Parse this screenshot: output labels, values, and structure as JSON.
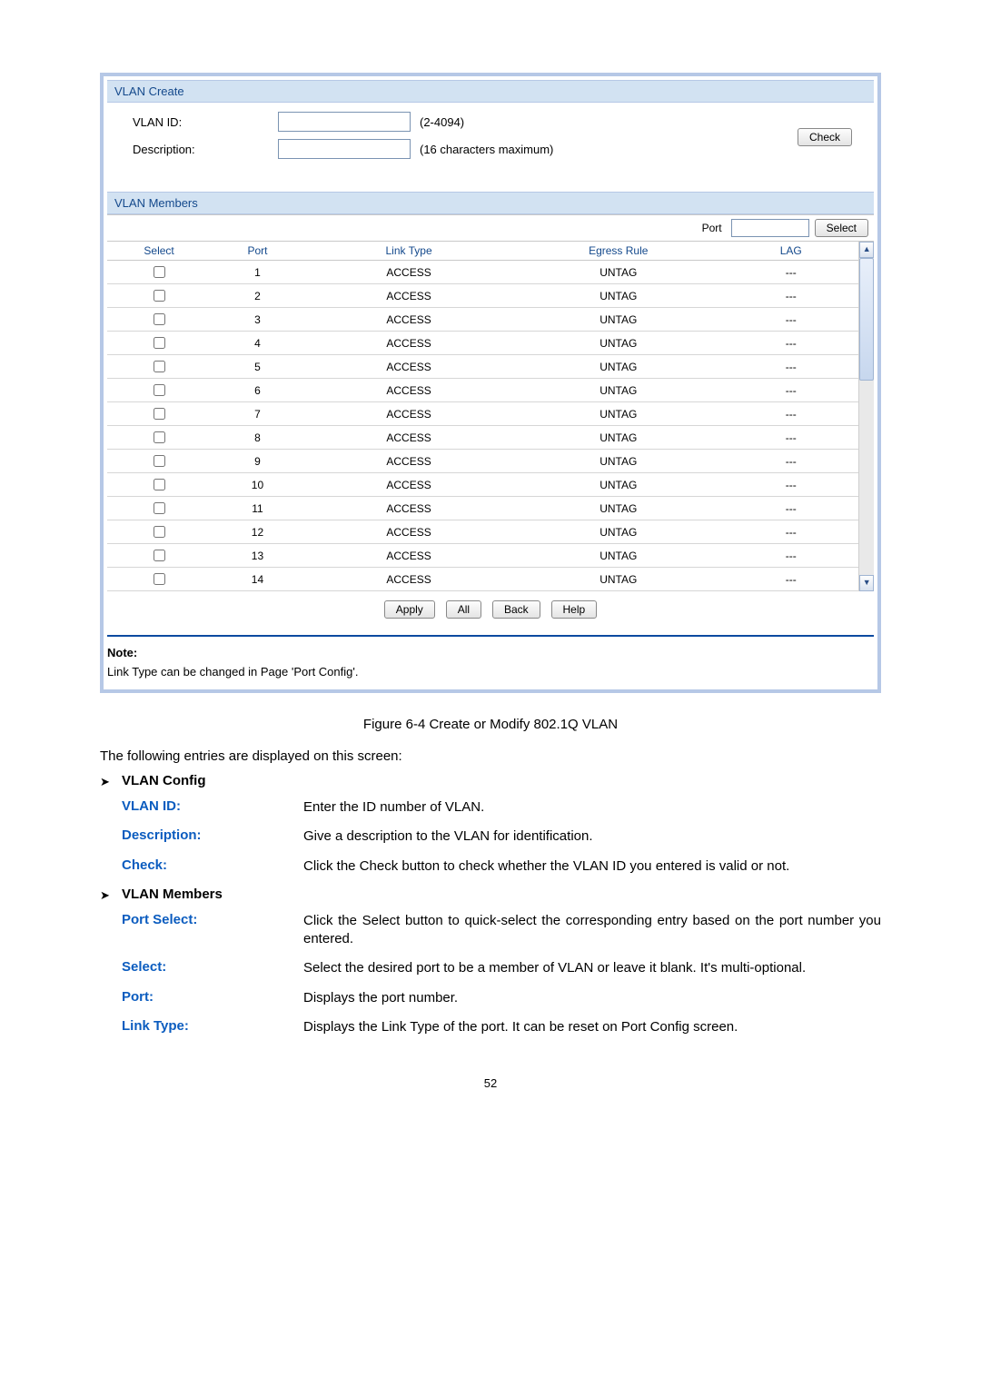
{
  "app": {
    "vlan_create": {
      "title": "VLAN Create",
      "vlan_id_label": "VLAN ID:",
      "vlan_id_value": "",
      "vlan_id_hint": "(2-4094)",
      "description_label": "Description:",
      "description_value": "",
      "description_hint": "(16 characters maximum)",
      "check_btn": "Check"
    },
    "vlan_members": {
      "title": "VLAN Members",
      "port_label": "Port",
      "port_value": "",
      "select_btn": "Select",
      "columns": {
        "select": "Select",
        "port": "Port",
        "link_type": "Link Type",
        "egress_rule": "Egress Rule",
        "lag": "LAG"
      },
      "rows": [
        {
          "port": "1",
          "link": "ACCESS",
          "egress": "UNTAG",
          "lag": "---"
        },
        {
          "port": "2",
          "link": "ACCESS",
          "egress": "UNTAG",
          "lag": "---"
        },
        {
          "port": "3",
          "link": "ACCESS",
          "egress": "UNTAG",
          "lag": "---"
        },
        {
          "port": "4",
          "link": "ACCESS",
          "egress": "UNTAG",
          "lag": "---"
        },
        {
          "port": "5",
          "link": "ACCESS",
          "egress": "UNTAG",
          "lag": "---"
        },
        {
          "port": "6",
          "link": "ACCESS",
          "egress": "UNTAG",
          "lag": "---"
        },
        {
          "port": "7",
          "link": "ACCESS",
          "egress": "UNTAG",
          "lag": "---"
        },
        {
          "port": "8",
          "link": "ACCESS",
          "egress": "UNTAG",
          "lag": "---"
        },
        {
          "port": "9",
          "link": "ACCESS",
          "egress": "UNTAG",
          "lag": "---"
        },
        {
          "port": "10",
          "link": "ACCESS",
          "egress": "UNTAG",
          "lag": "---"
        },
        {
          "port": "11",
          "link": "ACCESS",
          "egress": "UNTAG",
          "lag": "---"
        },
        {
          "port": "12",
          "link": "ACCESS",
          "egress": "UNTAG",
          "lag": "---"
        },
        {
          "port": "13",
          "link": "ACCESS",
          "egress": "UNTAG",
          "lag": "---"
        },
        {
          "port": "14",
          "link": "ACCESS",
          "egress": "UNTAG",
          "lag": "---"
        }
      ],
      "buttons": {
        "apply": "Apply",
        "all": "All",
        "back": "Back",
        "help": "Help"
      }
    },
    "note_label": "Note:",
    "note_body": "Link Type can be changed in Page 'Port Config'."
  },
  "doc": {
    "figure": "Figure 6-4 Create or Modify 802.1Q VLAN",
    "intro": "The following entries are displayed on this screen:",
    "sections": [
      {
        "title": "VLAN Config",
        "items": [
          {
            "term": "VLAN ID:",
            "text": "Enter the ID number of VLAN."
          },
          {
            "term": "Description:",
            "text": "Give a description to the VLAN for identification."
          },
          {
            "term": "Check:",
            "text": "Click the Check button to check whether the VLAN ID you entered is valid or not."
          }
        ]
      },
      {
        "title": "VLAN Members",
        "items": [
          {
            "term": "Port Select:",
            "text": "Click the Select button to quick-select the corresponding entry based on the port number you entered."
          },
          {
            "term": "Select:",
            "text": "Select the desired port to be a member of VLAN or leave it blank. It's multi-optional."
          },
          {
            "term": "Port:",
            "text": "Displays the port number."
          },
          {
            "term": "Link Type:",
            "text": "Displays the Link Type of the port. It can be reset on Port Config screen."
          }
        ]
      }
    ],
    "page_number": "52"
  }
}
